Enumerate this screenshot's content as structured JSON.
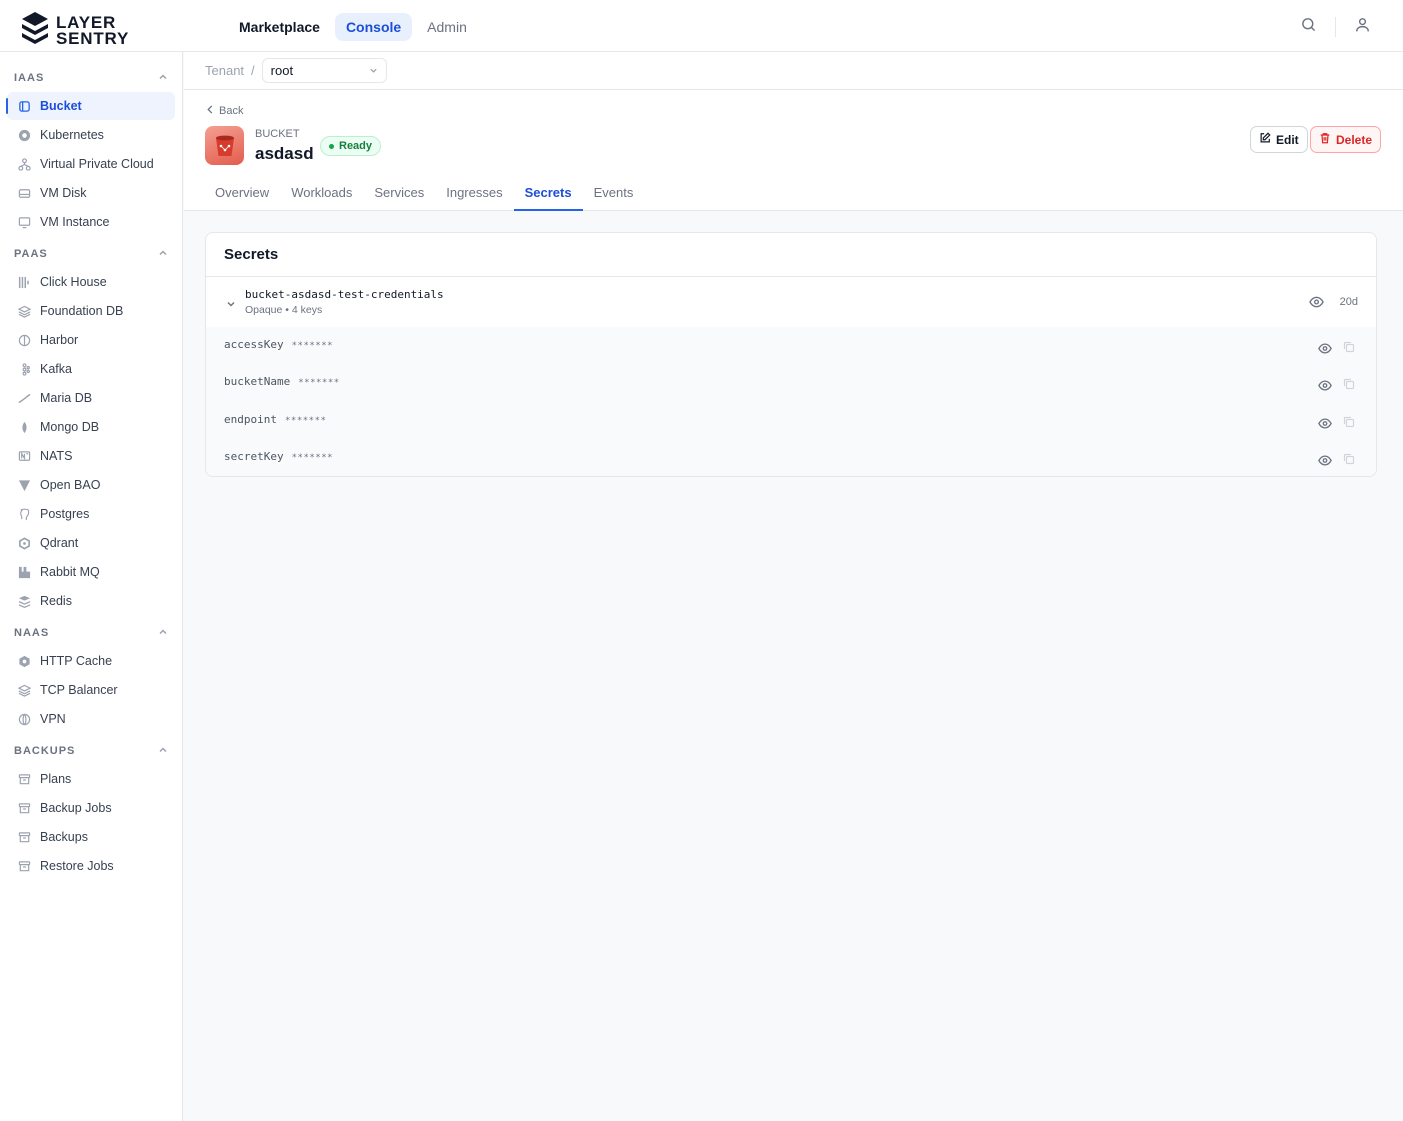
{
  "header": {
    "logo_line1": "LAYER",
    "logo_line2": "SENTRY",
    "nav": [
      {
        "label": "Marketplace"
      },
      {
        "label": "Console"
      },
      {
        "label": "Admin"
      }
    ]
  },
  "sidebar": {
    "sections": [
      {
        "title": "IAAS",
        "items": [
          "Bucket",
          "Kubernetes",
          "Virtual Private Cloud",
          "VM Disk",
          "VM Instance"
        ]
      },
      {
        "title": "PAAS",
        "items": [
          "Click House",
          "Foundation DB",
          "Harbor",
          "Kafka",
          "Maria DB",
          "Mongo DB",
          "NATS",
          "Open BAO",
          "Postgres",
          "Qdrant",
          "Rabbit MQ",
          "Redis"
        ]
      },
      {
        "title": "NAAS",
        "items": [
          "HTTP Cache",
          "TCP Balancer",
          "VPN"
        ]
      },
      {
        "title": "BACKUPS",
        "items": [
          "Plans",
          "Backup Jobs",
          "Backups",
          "Restore Jobs"
        ]
      }
    ]
  },
  "breadcrumb": {
    "tenant_label": "Tenant",
    "separator": "/",
    "tenant_value": "root"
  },
  "resource": {
    "back_label": "Back",
    "kind": "BUCKET",
    "name": "asdasd",
    "status": "Ready",
    "edit_label": "Edit",
    "delete_label": "Delete",
    "tabs": [
      "Overview",
      "Workloads",
      "Services",
      "Ingresses",
      "Secrets",
      "Events"
    ],
    "active_tab": "Secrets"
  },
  "secrets_card": {
    "title": "Secrets",
    "secret": {
      "name": "bucket-asdasd-test-credentials",
      "meta": "Opaque • 4 keys",
      "age": "20d",
      "keys": [
        {
          "name": "accessKey",
          "mask": "*******"
        },
        {
          "name": "bucketName",
          "mask": "*******"
        },
        {
          "name": "endpoint",
          "mask": "*******"
        },
        {
          "name": "secretKey",
          "mask": "*******"
        }
      ]
    }
  },
  "colors": {
    "accent": "#2563eb",
    "success": "#16a34a",
    "danger": "#dc2626"
  }
}
